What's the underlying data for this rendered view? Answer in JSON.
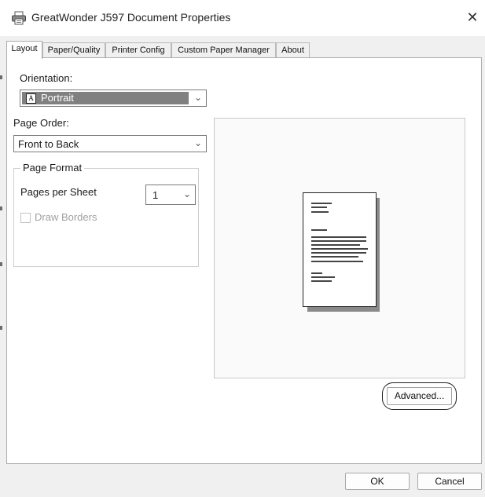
{
  "window": {
    "title": "GreatWonder J597 Document Properties",
    "close_glyph": "✕"
  },
  "tabs": [
    {
      "label": "Layout",
      "active": true
    },
    {
      "label": "Paper/Quality",
      "active": false
    },
    {
      "label": "Printer Config",
      "active": false
    },
    {
      "label": "Custom Paper Manager",
      "active": false
    },
    {
      "label": "About",
      "active": false
    }
  ],
  "layout": {
    "orientation_label": "Orientation:",
    "orientation_value": "Portrait",
    "orientation_icon_glyph": "A",
    "page_order_label": "Page Order:",
    "page_order_value": "Front to Back",
    "page_format": {
      "legend": "Page Format",
      "pages_per_sheet_label": "Pages per Sheet",
      "pages_per_sheet_value": "1",
      "draw_borders_label": "Draw Borders",
      "draw_borders_checked": false,
      "draw_borders_enabled": false
    },
    "advanced_label": "Advanced..."
  },
  "footer": {
    "ok_label": "OK",
    "cancel_label": "Cancel"
  },
  "icons": {
    "printer": "printer-icon",
    "dropdown": "chevron-down-icon"
  },
  "colors": {
    "selection": "#808080",
    "panel_bg": "#ffffff",
    "dialog_bg": "#f0f0f0"
  }
}
